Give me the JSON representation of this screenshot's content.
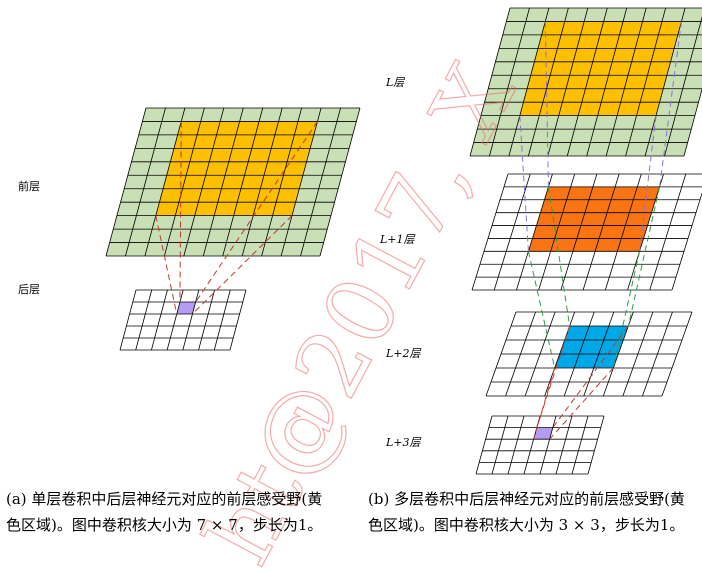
{
  "labels": {
    "a_prev": "前层",
    "a_next": "后层",
    "b_L": "L层",
    "b_L1": "L+1层",
    "b_L2": "L+2层",
    "b_L3": "L+3层"
  },
  "captions": {
    "a": "(a) 单层卷积中后层神经元对应的前层感受野(黄色区域)。图中卷积核大小为 7 × 7，步长为1。",
    "b": "(b) 多层卷积中后层神经元对应的前层感受野(黄色区域)。图中卷积核大小为 3 × 3，步长为1。"
  },
  "watermark": "ht@2017, X",
  "colors": {
    "grid_green": "#c9dfb5",
    "yellow": "#fcc000",
    "orange": "#f97412",
    "blue": "#00a8e8",
    "purple": "#b49cf2",
    "red_dash": "#c0392b",
    "green_dash": "#2f9e44",
    "purple_dash": "#8e6fd6"
  }
}
